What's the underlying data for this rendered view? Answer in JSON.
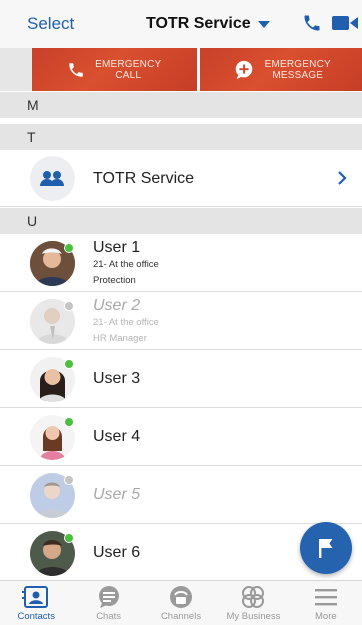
{
  "header": {
    "select_label": "Select",
    "title": "TOTR Service"
  },
  "emergency": {
    "call_line1": "EMERGENCY",
    "call_line2": "CALL",
    "message_line1": "EMERGENCY",
    "message_line2": "MESSAGE"
  },
  "sections": {
    "m": "M",
    "t": "T",
    "u": "U"
  },
  "group": {
    "name": "TOTR Service"
  },
  "users": [
    {
      "name": "User 1",
      "line1": "21- At the office",
      "line2": "Protection",
      "status": "online"
    },
    {
      "name": "User 2",
      "line1": "21- At the office",
      "line2": "HR Manager",
      "status": "offline"
    },
    {
      "name": "User 3",
      "status": "online"
    },
    {
      "name": "User 4",
      "status": "online"
    },
    {
      "name": "User 5",
      "status": "offline"
    },
    {
      "name": "User 6",
      "status": "online"
    }
  ],
  "tabs": [
    {
      "label": "Contacts",
      "icon": "contacts-icon",
      "active": true
    },
    {
      "label": "Chats",
      "icon": "chat-icon"
    },
    {
      "label": "Channels",
      "icon": "channels-icon"
    },
    {
      "label": "My Business",
      "icon": "business-icon"
    },
    {
      "label": "More",
      "icon": "menu-icon"
    }
  ],
  "colors": {
    "accent": "#1f5fad",
    "emergency": "#d24a2d",
    "online": "#49c13c",
    "offline": "#c4c4c4",
    "fab": "#2563ae"
  }
}
